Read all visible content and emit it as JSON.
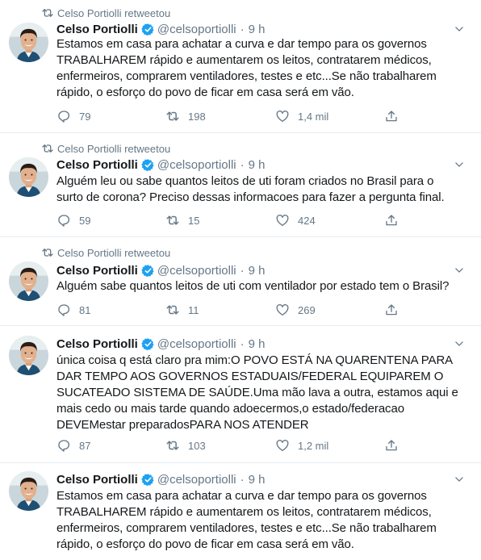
{
  "colors": {
    "icon": "#657786",
    "verified": "#1da1f2",
    "border": "#e6ecf0"
  },
  "tweets": [
    {
      "retweet_label": "Celso Portiolli retweetou",
      "name": "Celso Portiolli",
      "handle": "@celsoportiolli",
      "dot": "·",
      "time": "9 h",
      "text": "Estamos em casa para achatar a curva e dar tempo para os governos\nTRABALHAREM rápido e aumentarem os leitos, contratarem médicos,\nenfermeiros, comprarem ventiladores, testes e etc...Se não trabalharem\nrápido, o esforço do povo de ficar em casa será em vão.",
      "replies": "79",
      "retweets": "198",
      "likes": "1,4 mil"
    },
    {
      "retweet_label": "Celso Portiolli retweetou",
      "name": "Celso Portiolli",
      "handle": "@celsoportiolli",
      "dot": "·",
      "time": "9 h",
      "text": "Alguém leu ou sabe quantos leitos de uti foram criados no Brasil para o\nsurto de corona? Preciso dessas informacoes para fazer a pergunta final.",
      "replies": "59",
      "retweets": "15",
      "likes": "424"
    },
    {
      "retweet_label": "Celso Portiolli retweetou",
      "name": "Celso Portiolli",
      "handle": "@celsoportiolli",
      "dot": "·",
      "time": "9 h",
      "text": "Alguém sabe quantos leitos de uti com ventilador por estado tem o Brasil?",
      "replies": "81",
      "retweets": "11",
      "likes": "269"
    },
    {
      "name": "Celso Portiolli",
      "handle": "@celsoportiolli",
      "dot": "·",
      "time": "9 h",
      "text": "única coisa q está claro pra mim:O POVO ESTÁ NA QUARENTENA PARA\nDAR TEMPO AOS GOVERNOS ESTADUAIS/FEDERAL EQUIPAREM O\nSUCATEADO SISTEMA DE SAÚDE.Uma mão lava a outra, estamos aqui e\nmais cedo ou mais tarde quando adoecermos,o estado/federacao\nDEVEMestar preparadosPARA NOS ATENDER",
      "replies": "87",
      "retweets": "103",
      "likes": "1,2 mil"
    },
    {
      "name": "Celso Portiolli",
      "handle": "@celsoportiolli",
      "dot": "·",
      "time": "9 h",
      "text": "Estamos em casa para achatar a curva e dar tempo para os governos\nTRABALHAREM rápido e aumentarem os leitos, contratarem médicos,\nenfermeiros, comprarem ventiladores, testes e etc...Se não trabalharem\nrápido, o esforço do povo de ficar em casa será em vão."
    }
  ]
}
